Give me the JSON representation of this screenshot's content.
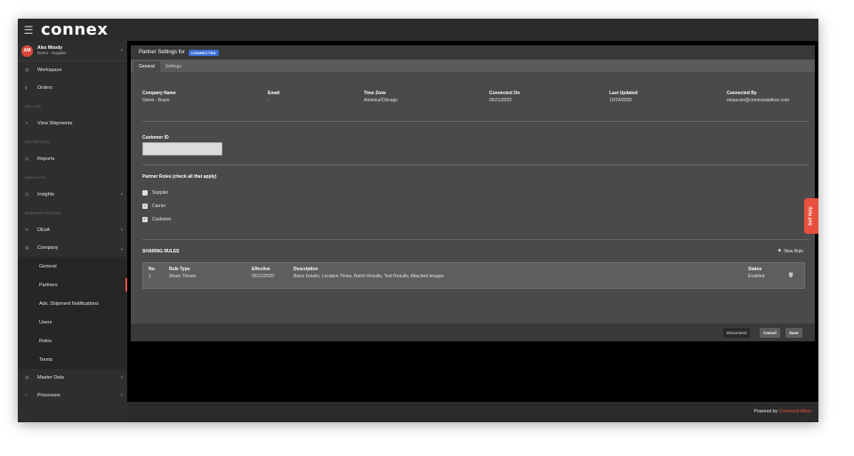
{
  "app": {
    "logo": "conneх",
    "menu_icon": "hamburger-icon"
  },
  "user": {
    "initials": "AM",
    "name": "Alex Moody",
    "org": "Demo - Supplier"
  },
  "sidebar": {
    "workspace": "Workspace",
    "orders": "Orders",
    "section_seller": "SELLER",
    "view_shipments": "View Shipments",
    "section_reporting": "REPORTING",
    "reports": "Reports",
    "section_analysis": "ANALYSIS",
    "insights": "Insights",
    "section_administration": "ADMINISTRATION",
    "dexa": "DExA",
    "company": "Company",
    "company_sub": [
      "General",
      "Partners",
      "Adv. Shipment Notifications",
      "Users",
      "Roles",
      "Terms"
    ],
    "master_data": "Master Data",
    "processes": "Processes"
  },
  "card": {
    "title": "Partner Settings for",
    "badge": "CONNECTED",
    "tabs": [
      "General",
      "Settings"
    ],
    "company": {
      "headers": [
        "Company Name",
        "Email",
        "Time Zone",
        "Connected On",
        "Last Updated",
        "Connected By"
      ],
      "values": [
        "Demo - Buyer",
        "-",
        "America/Chicago",
        "05/21/2020",
        "10/14/2020",
        "msaucier@commandalkon.com"
      ]
    },
    "customer_id_label": "Customer ID",
    "customer_id_value": "",
    "roles_title": "Partner Roles (check all that apply)",
    "roles": [
      {
        "label": "Supplier",
        "checked": false
      },
      {
        "label": "Carrier",
        "checked": true
      },
      {
        "label": "Customer",
        "checked": true
      }
    ],
    "sharing_title": "SHARING RULES",
    "new_rule": "New Rule",
    "rules_headers": [
      "No.",
      "Rule Type",
      "Effective",
      "Description",
      "Status"
    ],
    "rules": [
      {
        "no": "1",
        "type": "Share Tickets",
        "effective": "05/21/2020",
        "description": "Basic Details, Location Times, Batch Results, Test Results, Attached Images",
        "status": "Enabled"
      }
    ]
  },
  "footer": {
    "disconnect": "Disconnect",
    "cancel": "Cancel",
    "save": "Save"
  },
  "self_help": "Self Help",
  "powered_by": {
    "prefix": "Powered by",
    "brand": "Command Alkon"
  },
  "colors": {
    "accent": "#e8503e",
    "badge": "#3a6fd8"
  }
}
